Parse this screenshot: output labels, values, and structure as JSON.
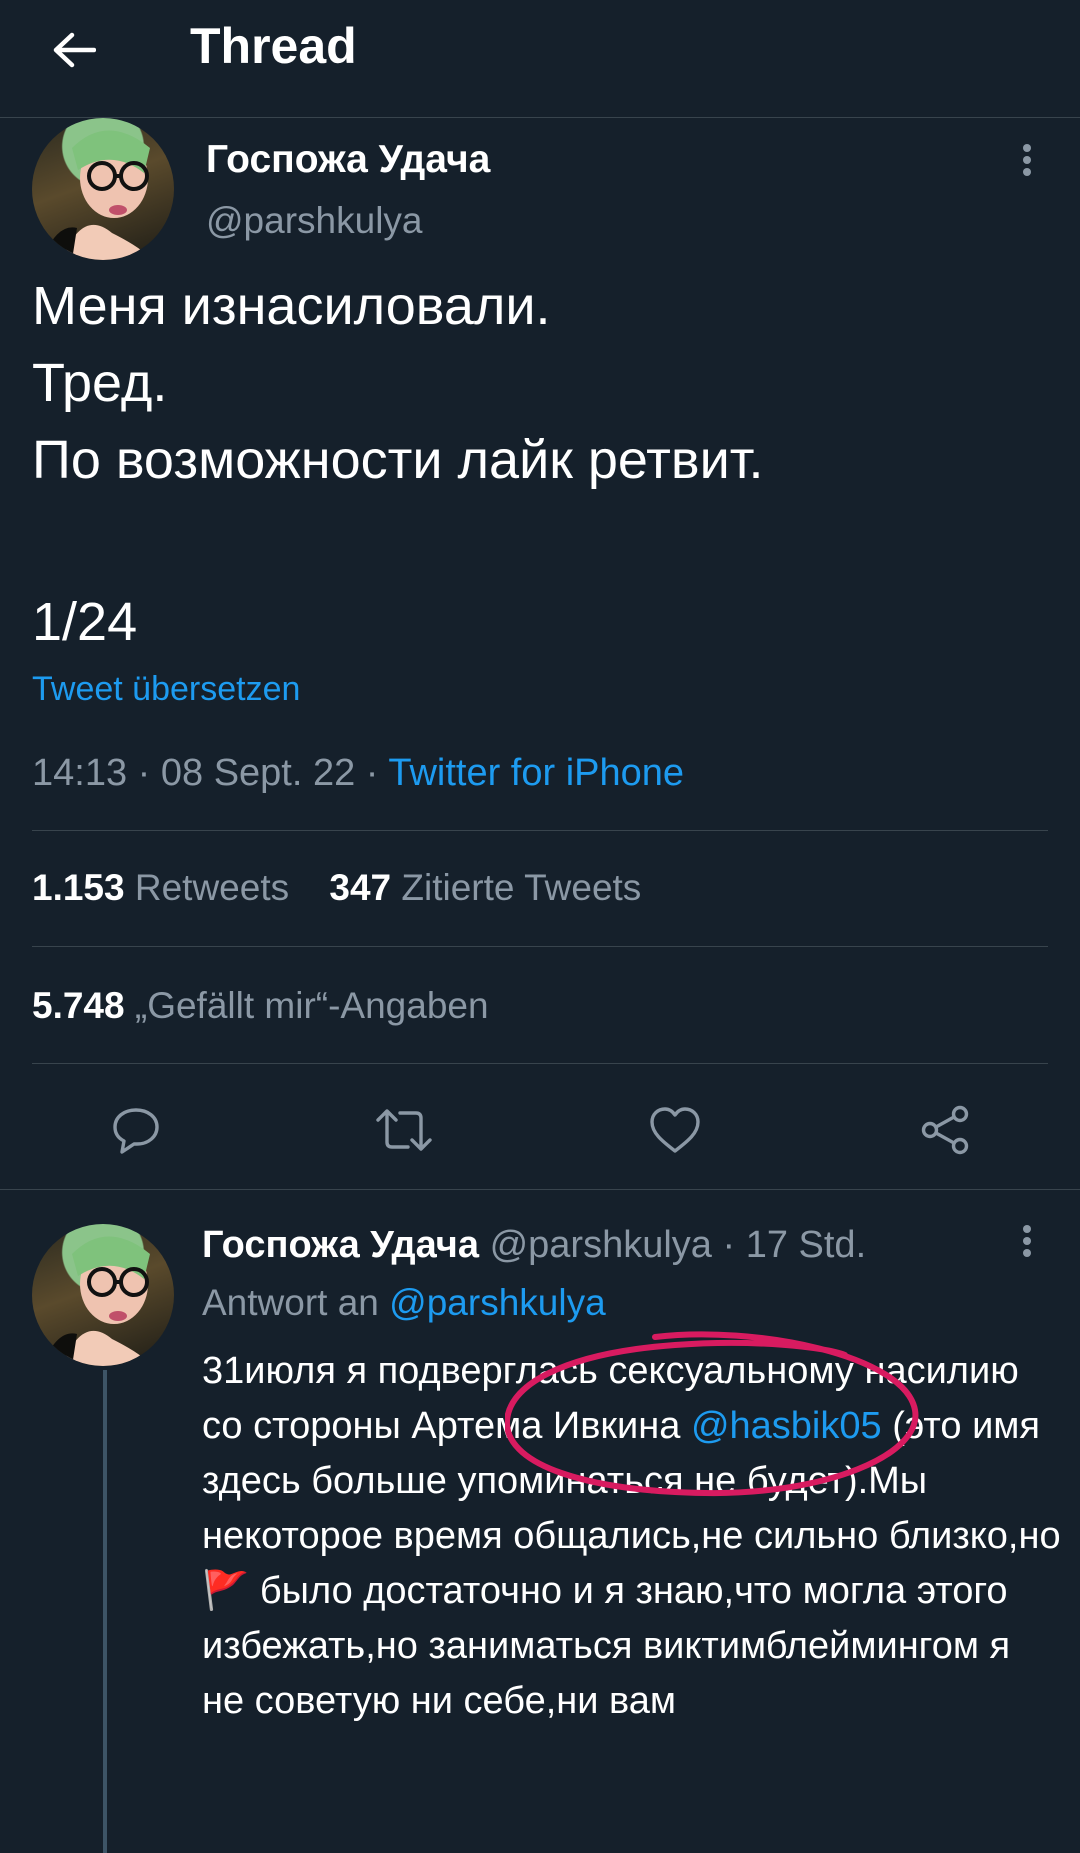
{
  "header": {
    "title": "Thread"
  },
  "main_tweet": {
    "display_name": "Госпожа Удача",
    "handle": "@parshkulya",
    "text_lines": [
      "Меня изнасиловали.",
      "Тред.",
      "По возможности лайк ретвит.",
      "",
      "1/24"
    ],
    "translate_link": "Tweet übersetzen",
    "timestamp": "14:13 · 08 Sept. 22 · ",
    "source": "Twitter for iPhone",
    "retweets_count": "1.153",
    "retweets_label": "Retweets",
    "quotes_count": "347",
    "quotes_label": "Zitierte Tweets",
    "likes_count": "5.748",
    "likes_label": "„Gefällt mir“-Angaben"
  },
  "actions": {
    "reply_icon": "reply-icon",
    "retweet_icon": "retweet-icon",
    "like_icon": "heart-icon",
    "share_icon": "share-icon"
  },
  "reply_tweet": {
    "display_name": "Госпожа Удача",
    "handle": "@parshkulya",
    "separator": " · ",
    "time_ago": "17 Std.",
    "reply_to_label": "Antwort an ",
    "reply_to_handle": "@parshkulya",
    "text_part1": "31июля я подверглась сексуальному насилию со стороны Артема Ивкина ",
    "mention": "@hasbik05",
    "text_part2": " (это имя здесь больше упоминаться не будет).Мы некоторое время общались,не сильно близко,но ",
    "flag_emoji": "🚩",
    "text_part3": " было достаточно и я знаю,что могла этого избежать,но заниматься виктимблеймингом я не советую ни себе,ни вам"
  },
  "colors": {
    "background": "#15202b",
    "divider": "#38444d",
    "muted_text": "#8b98a5",
    "link": "#1d9bf0",
    "annotation": "#d81b60"
  }
}
